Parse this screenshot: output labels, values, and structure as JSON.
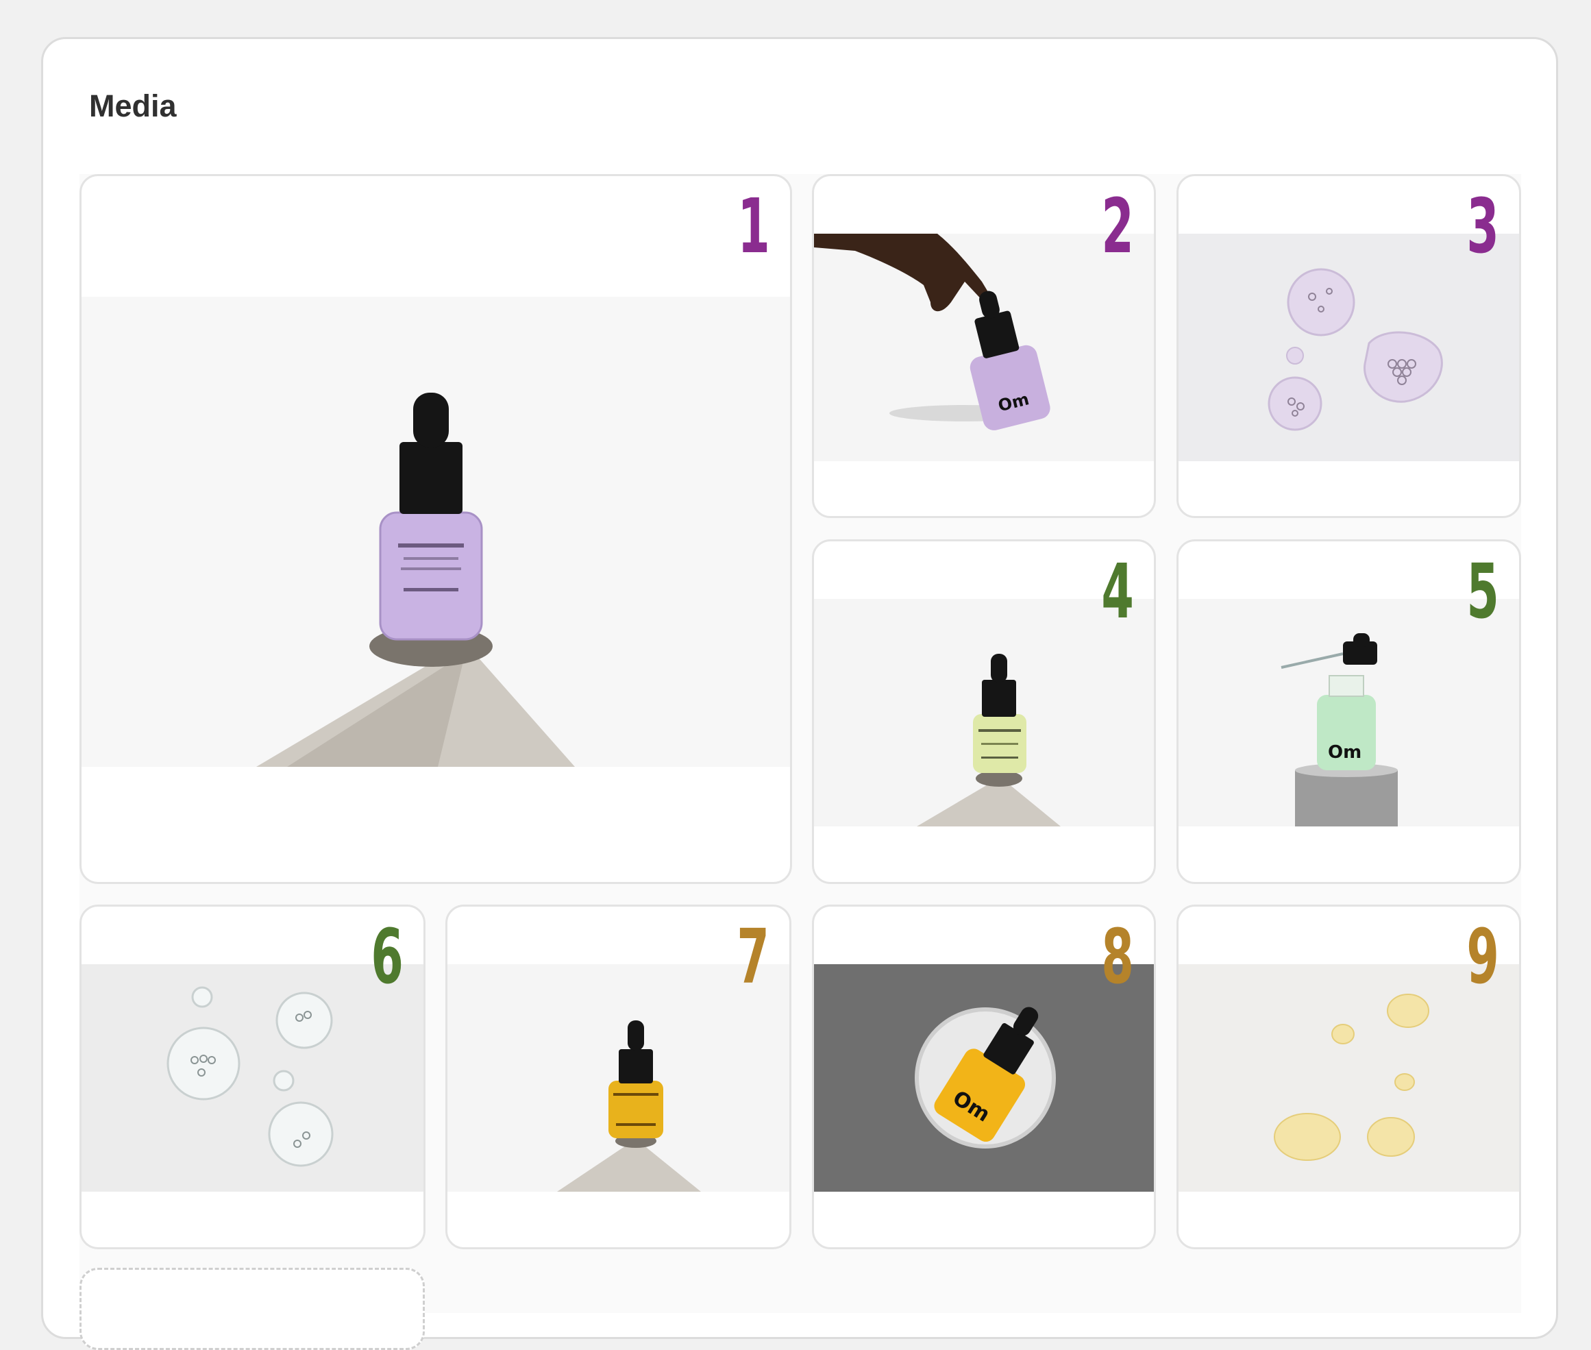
{
  "card": {
    "title": "Media"
  },
  "colors": {
    "tier_1": "#8a2c8f",
    "tier_2": "#4f7a2e",
    "tier_3": "#b5832a",
    "card_border": "#dcdcdc",
    "tile_border": "#e3e3e3"
  },
  "media": [
    {
      "number": "1",
      "tier": "tier_1",
      "subject": "purple-serum-bottle-on-rock"
    },
    {
      "number": "2",
      "tier": "tier_1",
      "subject": "hand-pressing-purple-serum-dropper"
    },
    {
      "number": "3",
      "tier": "tier_1",
      "subject": "lilac-serum-droplets"
    },
    {
      "number": "4",
      "tier": "tier_2",
      "subject": "green-serum-bottle-on-rock"
    },
    {
      "number": "5",
      "tier": "tier_2",
      "subject": "green-serum-bottle-on-pedestal"
    },
    {
      "number": "6",
      "tier": "tier_2",
      "subject": "clear-serum-droplets"
    },
    {
      "number": "7",
      "tier": "tier_3",
      "subject": "amber-serum-bottle-on-rock"
    },
    {
      "number": "8",
      "tier": "tier_3",
      "subject": "amber-serum-bottle-in-circle-frame"
    },
    {
      "number": "9",
      "tier": "tier_3",
      "subject": "golden-oil-droplets"
    }
  ]
}
